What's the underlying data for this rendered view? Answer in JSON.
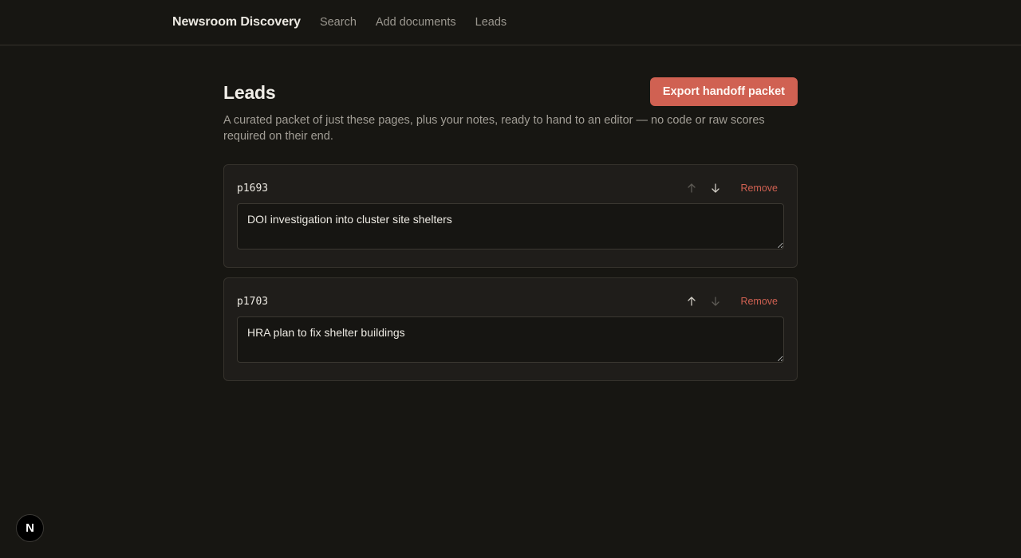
{
  "nav": {
    "brand": "Newsroom Discovery",
    "links": [
      "Search",
      "Add documents",
      "Leads"
    ]
  },
  "page": {
    "title": "Leads",
    "export_label": "Export handoff packet",
    "subtitle": "A curated packet of just these pages, plus your notes, ready to hand to an editor — no code or raw scores required on their end."
  },
  "leads": [
    {
      "id": "p1693",
      "note": "DOI investigation into cluster site shelters",
      "up_enabled": false,
      "down_enabled": true,
      "remove_label": "Remove"
    },
    {
      "id": "p1703",
      "note": "HRA plan to fix shelter buildings",
      "up_enabled": true,
      "down_enabled": false,
      "remove_label": "Remove"
    }
  ],
  "badge": {
    "letter": "N",
    "icon": "nextjs-logo-icon"
  },
  "colors": {
    "background": "#171612",
    "accent": "#d06152",
    "card": "#1f1d1a"
  }
}
